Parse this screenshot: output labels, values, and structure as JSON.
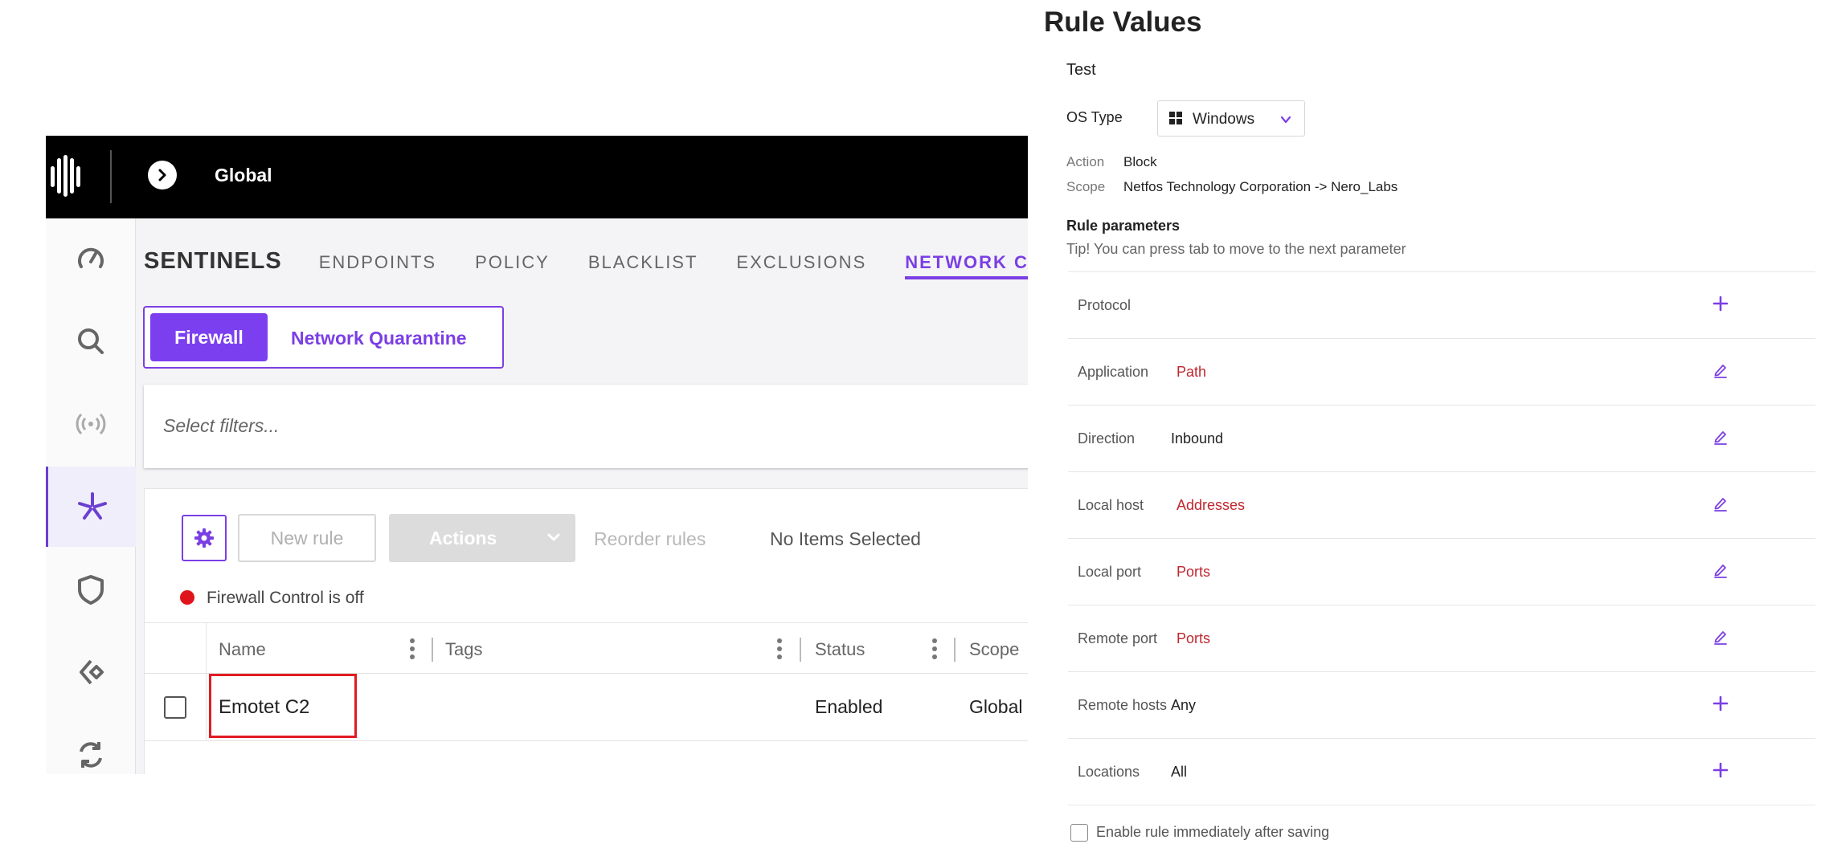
{
  "app": {
    "scope_title": "Global",
    "brand": "SENTINELS",
    "tabs": [
      {
        "label": "ENDPOINTS"
      },
      {
        "label": "POLICY"
      },
      {
        "label": "BLACKLIST"
      },
      {
        "label": "EXCLUSIONS"
      },
      {
        "label": "NETWORK CONT"
      }
    ],
    "subtabs": {
      "firewall": "Firewall",
      "network_quarantine": "Network Quarantine"
    },
    "filter_placeholder": "Select filters...",
    "toolbar": {
      "new_rule": "New rule",
      "actions": "Actions",
      "reorder_rules": "Reorder rules",
      "no_items_selected": "No Items Selected"
    },
    "firewall_status": "Firewall Control is off",
    "table": {
      "columns": [
        "Name",
        "Tags",
        "Status",
        "Scope"
      ],
      "rows": [
        {
          "name": "Emotet C2",
          "tags": "",
          "status": "Enabled",
          "scope": "Global"
        }
      ]
    },
    "sidebar_icons": [
      "dashboard-gauge-icon",
      "search-icon",
      "broadcast-icon",
      "sentinel-asterisk-icon",
      "shield-icon",
      "diamond-arrows-icon",
      "sync-arrows-icon"
    ],
    "colors": {
      "accent": "#7b3fe4",
      "status_red": "#e0141b",
      "highlight_red": "#e11b22"
    }
  },
  "rule_values": {
    "title": "Rule Values",
    "rule_name": "Test",
    "os_type_label": "OS Type",
    "os_type_value": "Windows",
    "action_label": "Action",
    "action_value": "Block",
    "scope_label": "Scope",
    "scope_value": "Netfos Technology Corporation -> Nero_Labs",
    "params_heading": "Rule parameters",
    "params_tip": "Tip! You can press tab to move to the next parameter",
    "params": [
      {
        "label": "Protocol",
        "value": "",
        "action": "add"
      },
      {
        "label": "Application",
        "value": "Path",
        "action": "edit",
        "placeholder": true
      },
      {
        "label": "Direction",
        "value": "Inbound",
        "action": "edit",
        "placeholder": false
      },
      {
        "label": "Local host",
        "value": "Addresses",
        "action": "edit",
        "placeholder": true
      },
      {
        "label": "Local port",
        "value": "Ports",
        "action": "edit",
        "placeholder": true
      },
      {
        "label": "Remote port",
        "value": "Ports",
        "action": "edit",
        "placeholder": true
      },
      {
        "label": "Remote hosts",
        "value": "Any",
        "action": "add",
        "placeholder": false
      },
      {
        "label": "Locations",
        "value": "All",
        "action": "add",
        "placeholder": false
      }
    ],
    "enable_label": "Enable rule immediately after saving",
    "enable_checked": false
  }
}
